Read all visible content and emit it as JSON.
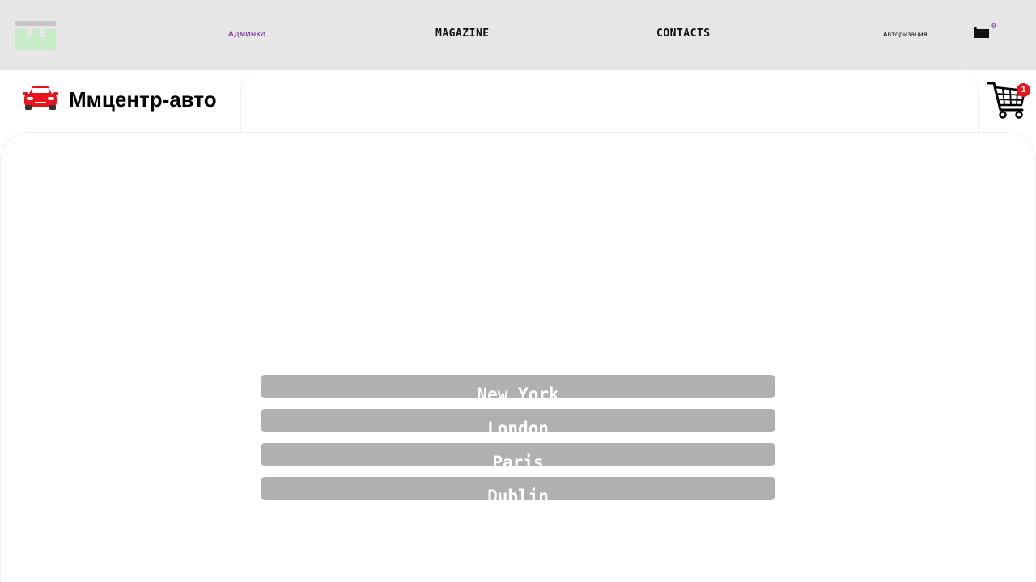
{
  "header": {
    "nav": {
      "admin": "Админка",
      "magazine": "MAGAZINE",
      "contacts": "CONTACTS",
      "auth": "Авторизация"
    },
    "cart_count": "0"
  },
  "brand": {
    "name": "Ммцентр-авто",
    "logo_icon": "car-icon"
  },
  "cart": {
    "badge": "1",
    "icon": "shopping-cart-icon"
  },
  "cities": [
    "New York",
    "London",
    "Paris",
    "Dublin"
  ],
  "colors": {
    "topbar_bg": "#e6e6e6",
    "admin_link": "#7a1fa2",
    "badge": "#e8131b",
    "city_item_bg": "#b0b0b0"
  }
}
